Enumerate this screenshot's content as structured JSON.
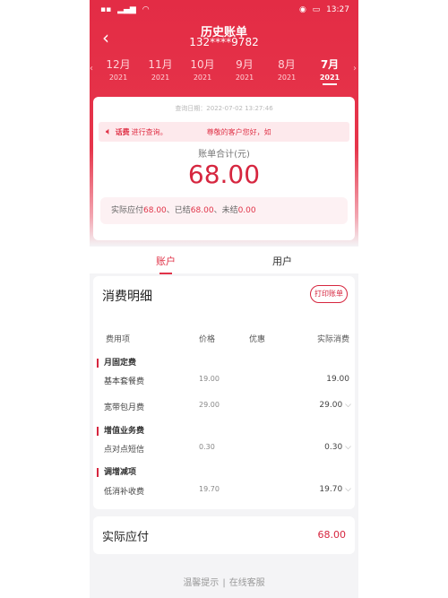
{
  "status": {
    "time": "13:27"
  },
  "header": {
    "title": "历史账单",
    "phone": "132****9782"
  },
  "months": [
    {
      "month": "12月",
      "year": "2021"
    },
    {
      "month": "11月",
      "year": "2021"
    },
    {
      "month": "10月",
      "year": "2021"
    },
    {
      "month": "9月",
      "year": "2021"
    },
    {
      "month": "8月",
      "year": "2021"
    },
    {
      "month": "7月",
      "year": "2021"
    }
  ],
  "bill": {
    "query_time": "查询日期：2022-07-02 13:27:46",
    "notice_tag": "话费",
    "notice_text": "进行查询。",
    "notice_scroll": "尊敬的客户您好，如",
    "total_label": "账单合计(元)",
    "total_value": "68.00",
    "summary_prefix": "实际应付",
    "summary_paid_label": "、已结",
    "summary_unpaid_label": "、未结",
    "payable": "68.00",
    "paid": "68.00",
    "unpaid": "0.00"
  },
  "tabs": [
    "账户",
    "用户"
  ],
  "detail": {
    "title": "消费明细",
    "print_button": "打印账单",
    "columns": [
      "费用项",
      "价格",
      "优惠",
      "实际消费"
    ],
    "sections": [
      {
        "name": "月固定费",
        "items": [
          {
            "name": "基本套餐费",
            "price": "19.00",
            "actual": "19.00"
          },
          {
            "name": "宽带包月费",
            "price": "29.00",
            "actual": "29.00"
          }
        ]
      },
      {
        "name": "增值业务费",
        "items": [
          {
            "name": "点对点短信",
            "price": "0.30",
            "actual": "0.30"
          }
        ]
      },
      {
        "name": "调增减项",
        "items": [
          {
            "name": "低消补收费",
            "price": "19.70",
            "actual": "19.70"
          }
        ]
      }
    ]
  },
  "total": {
    "label": "实际应付",
    "value": "68.00"
  },
  "footer": {
    "tips": "温馨提示",
    "service": "在线客服"
  }
}
